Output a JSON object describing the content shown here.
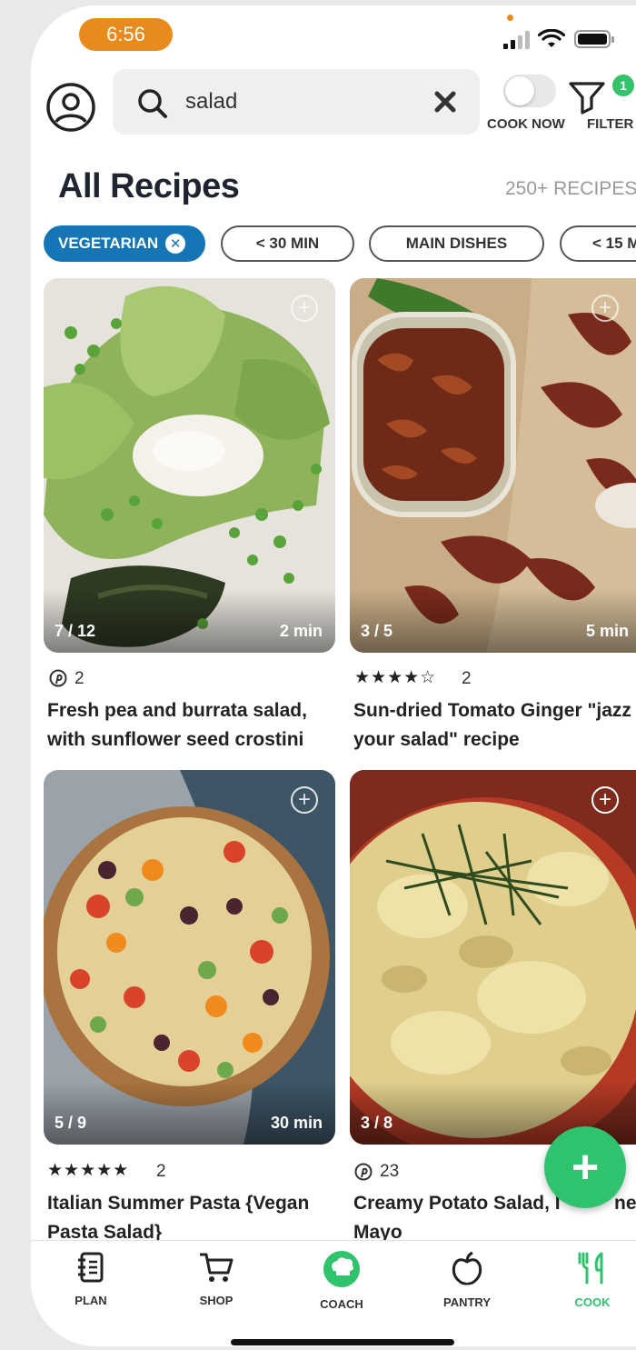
{
  "status_bar": {
    "time": "6:56"
  },
  "search": {
    "query": "salad",
    "cook_now_label": "COOK NOW",
    "filter_label": "FILTER",
    "filter_badge": "1"
  },
  "header": {
    "title": "All Recipes",
    "count": "250+ RECIPES"
  },
  "chips": [
    {
      "label": "VEGETARIAN",
      "active": true
    },
    {
      "label": "< 30 MIN",
      "active": false
    },
    {
      "label": "MAIN DISHES",
      "active": false
    },
    {
      "label": "< 15 M",
      "active": false
    }
  ],
  "recipes": [
    {
      "photo_index": "7 / 12",
      "time": "2 min",
      "meta_icon": "pinterest-icon",
      "meta_count": "2",
      "title": "Fresh pea and burrata salad, with sunflower seed crostini"
    },
    {
      "photo_index": "3 / 5",
      "time": "5 min",
      "rating_stars": 4.5,
      "meta_count": "2",
      "title": "Sun-dried Tomato Ginger \"jazz up your salad\" recipe"
    },
    {
      "photo_index": "5 / 9",
      "time": "30 min",
      "rating_stars": 5,
      "meta_count": "2",
      "title": "Italian Summer Pasta {Vegan Pasta Salad}"
    },
    {
      "photo_index": "3 / 8",
      "time": "",
      "meta_icon": "pinterest-icon",
      "meta_count": "23",
      "title_line1": "Creamy Potato Salad, I",
      "title_line1_end": "ne",
      "title_line2": "Mayo"
    }
  ],
  "tabs": [
    {
      "label": "PLAN",
      "icon": "notebook-icon"
    },
    {
      "label": "SHOP",
      "icon": "cart-icon"
    },
    {
      "label": "COACH",
      "icon": "chef-hat-icon"
    },
    {
      "label": "PANTRY",
      "icon": "apple-icon"
    },
    {
      "label": "COOK",
      "icon": "utensils-icon",
      "active": true
    }
  ],
  "colors": {
    "accent_green": "#2fc36d",
    "chip_blue": "#1676b5",
    "time_orange": "#e98a1d"
  }
}
